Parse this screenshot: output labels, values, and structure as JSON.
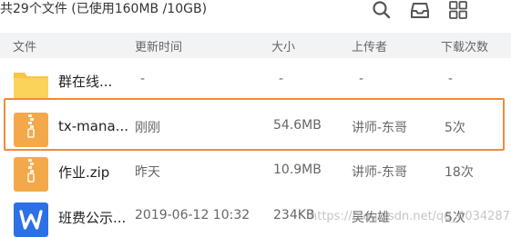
{
  "summary": "共29个文件 (已使用160MB /10GB)",
  "toolbar": {
    "icons": [
      "search-icon",
      "inbox-icon",
      "grid-icon"
    ]
  },
  "columns": {
    "name": "文件",
    "updated": "更新时间",
    "size": "大小",
    "uploader": "上传者",
    "downloads": "下载次数"
  },
  "files": [
    {
      "icon": "folder-icon",
      "name": "群在线...",
      "updated": "-",
      "size": "-",
      "uploader": "-",
      "downloads": "-"
    },
    {
      "icon": "zip-icon",
      "name": "tx-mana...",
      "updated": "刚刚",
      "size": "54.6MB",
      "uploader": "讲师-东哥",
      "downloads": "5次"
    },
    {
      "icon": "zip-icon",
      "name": "作业.zip",
      "updated": "昨天",
      "size": "10.9MB",
      "uploader": "讲师-东哥",
      "downloads": "18次"
    },
    {
      "icon": "word-doc-icon",
      "name": "班费公示...",
      "updated": "2019-06-12 10:32",
      "size": "234KB",
      "uploader": "吴佐雄",
      "downloads": "5次"
    }
  ],
  "colors": {
    "folder": "#f7c547",
    "zip": "#f3a94a",
    "word": "#2d6fe6",
    "highlight": "#f08a3a"
  },
  "watermark": "https://blog.csdn.net/qq_40342872"
}
